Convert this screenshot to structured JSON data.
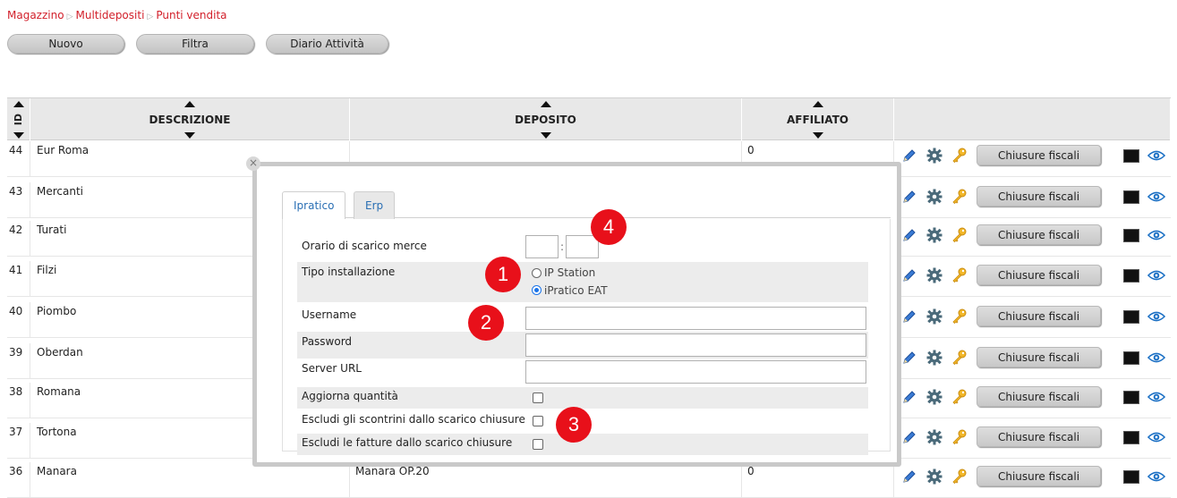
{
  "breadcrumb": {
    "items": [
      "Magazzino",
      "Multidepositi",
      "Punti vendita"
    ],
    "separator": "▷"
  },
  "toolbar": {
    "new_label": "Nuovo",
    "filter_label": "Filtra",
    "diary_label": "Diario Attività"
  },
  "table": {
    "headers": {
      "id": "ID",
      "description": "DESCRIZIONE",
      "deposit": "DEPOSITO",
      "affiliate": "AFFILIATO"
    },
    "action_button_label": "Chiusure fiscali",
    "rows": [
      {
        "id": "44",
        "description": "Eur Roma",
        "deposit": "",
        "affiliate": "0"
      },
      {
        "id": "43",
        "description": "Mercanti",
        "deposit": "",
        "affiliate": ""
      },
      {
        "id": "42",
        "description": "Turati",
        "deposit": "",
        "affiliate": ""
      },
      {
        "id": "41",
        "description": "Filzi",
        "deposit": "",
        "affiliate": ""
      },
      {
        "id": "40",
        "description": "Piombo",
        "deposit": "",
        "affiliate": ""
      },
      {
        "id": "39",
        "description": "Oberdan",
        "deposit": "",
        "affiliate": ""
      },
      {
        "id": "38",
        "description": "Romana",
        "deposit": "",
        "affiliate": ""
      },
      {
        "id": "37",
        "description": "Tortona",
        "deposit": "",
        "affiliate": ""
      },
      {
        "id": "36",
        "description": "Manara",
        "deposit": "Manara OP.20",
        "affiliate": "0"
      }
    ]
  },
  "modal": {
    "close_label": "×",
    "tabs": [
      "Ipratico",
      "Erp"
    ],
    "active_tab": "Ipratico",
    "fields": {
      "orario_label": "Orario di scarico merce",
      "orario_sep": ":",
      "tipo_label": "Tipo installazione",
      "tipo_options": [
        "IP Station",
        "iPratico EAT"
      ],
      "tipo_selected": "iPratico EAT",
      "username_label": "Username",
      "password_label": "Password",
      "server_label": "Server URL",
      "aggiorna_label": "Aggiorna quantità",
      "escludi_scontrini_label": "Escludi gli scontrini dallo scarico chiusure",
      "escludi_fatture_label": "Escludi le fatture dallo scarico chiusure"
    }
  },
  "annotations": [
    "1",
    "2",
    "3",
    "4"
  ],
  "colors": {
    "breadcrumb": "#d21f2a",
    "tab_text": "#2a6fb4",
    "badge": "#e8101a",
    "header_bg": "#e8e8e8"
  }
}
